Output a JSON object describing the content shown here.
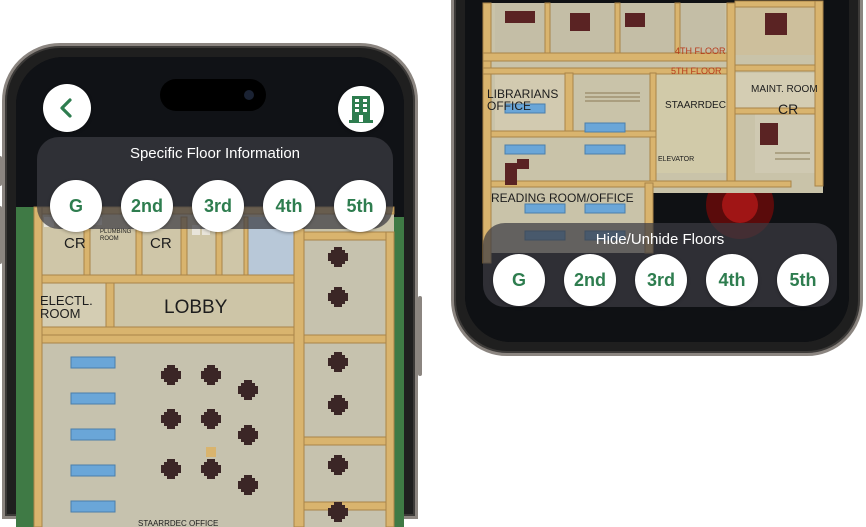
{
  "colors": {
    "accent_green": "#2e7d4f",
    "wall_tan": "#d9b46e",
    "floor_gray": "#c9c3a9",
    "table_dark": "#3b2626",
    "desk_blue": "#6aa6d8"
  },
  "left_screen": {
    "back_icon": "chevron-left-icon",
    "building_icon": "building-icon",
    "panel_title": "Specific Floor Information",
    "floors": [
      "G",
      "2nd",
      "3rd",
      "4th",
      "5th"
    ],
    "map_labels": {
      "cr_left": "CR",
      "plumbing_room": "PLUMBING ROOM",
      "cr_right": "CR",
      "electrical_room": "ELECTL. ROOM",
      "lobby": "LOBBY",
      "staarrdec_office": "STAARRDEC OFFICE"
    }
  },
  "right_screen": {
    "panel_title": "Hide/Unhide Floors",
    "floors": [
      "G",
      "2nd",
      "3rd",
      "4th",
      "5th"
    ],
    "map_labels": {
      "fourth_floor": "4TH FLOOR",
      "fifth_floor": "5TH FLOOR",
      "librarians_office": "LIBRARIANS OFFICE",
      "staarrdec": "STAARRDEC",
      "maint_room": "MAINT. ROOM",
      "cr": "CR",
      "elevator": "ELEVATOR",
      "reading_room": "READING ROOM/OFFICE"
    }
  }
}
